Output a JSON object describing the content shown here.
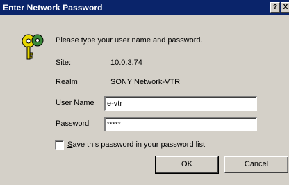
{
  "window": {
    "title": "Enter Network Password",
    "help_glyph": "?",
    "close_glyph": "X"
  },
  "dialog": {
    "icon": "key-icon",
    "prompt": "Please type your user name and password.",
    "site_label": "Site:",
    "site_value": "10.0.3.74",
    "realm_label": "Realm",
    "realm_value": "SONY Network-VTR",
    "username_label_accel": "U",
    "username_label_rest": "ser Name",
    "username_value": "e-vtr",
    "password_label_accel": "P",
    "password_label_rest": "assword",
    "password_value": "*****",
    "save_checkbox_accel": "S",
    "save_checkbox_rest": "ave this password in your password list",
    "save_checked": false
  },
  "buttons": {
    "ok": "OK",
    "cancel": "Cancel"
  }
}
